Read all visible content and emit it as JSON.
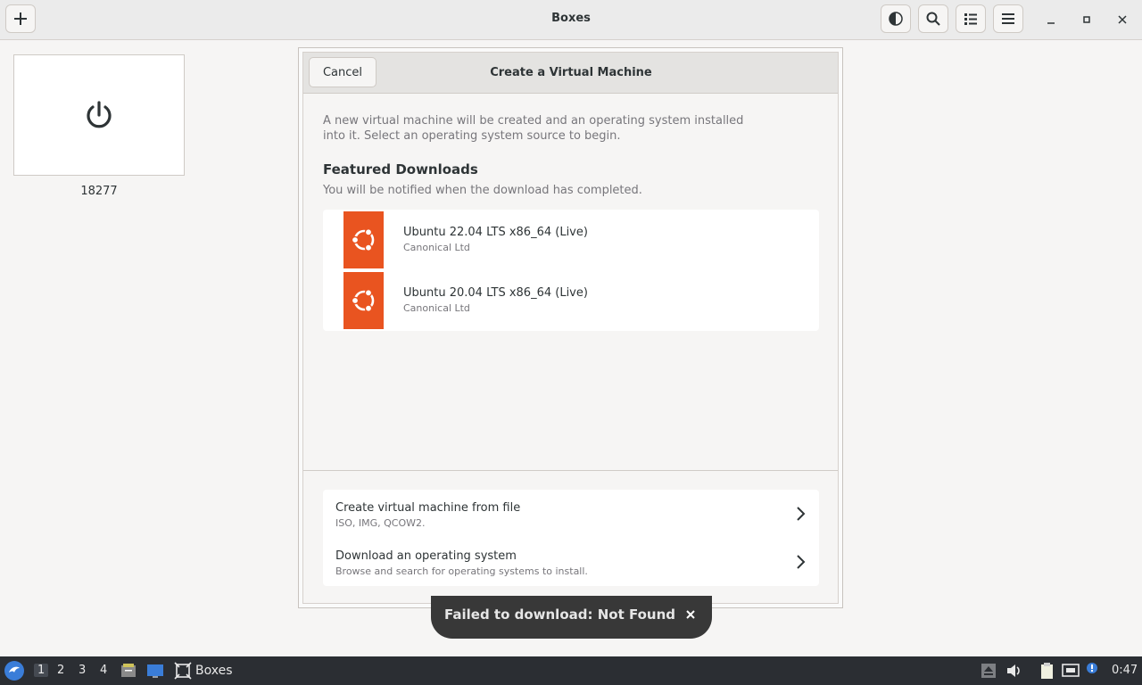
{
  "app": {
    "title": "Boxes"
  },
  "header": {
    "add_icon": "plus-icon",
    "theme_icon": "half-circle-icon",
    "search_icon": "search-icon",
    "view_icon": "list-view-icon",
    "menu_icon": "hamburger-icon"
  },
  "vm": {
    "name": "18277",
    "icon": "power-icon"
  },
  "dialog": {
    "cancel_label": "Cancel",
    "title": "Create a Virtual Machine",
    "intro_line1": "A new virtual machine will be created and an operating system installed",
    "intro_line2": "into it. Select an operating system source to begin.",
    "featured_title": "Featured Downloads",
    "featured_subtitle": "You will be notified when the download has completed.",
    "downloads": [
      {
        "name": "Ubuntu 22.04 LTS x86_64 (Live)",
        "vendor": "Canonical Ltd",
        "icon": "ubuntu-logo-icon"
      },
      {
        "name": "Ubuntu 20.04 LTS x86_64 (Live)",
        "vendor": "Canonical Ltd",
        "icon": "ubuntu-logo-icon"
      }
    ],
    "options": [
      {
        "title": "Create virtual machine from file",
        "subtitle": "ISO, IMG, QCOW2."
      },
      {
        "title": "Download an operating system",
        "subtitle": "Browse and search for operating systems to install."
      }
    ]
  },
  "toast": {
    "message": "Failed to download: Not Found"
  },
  "taskbar": {
    "workspaces": [
      "1",
      "2",
      "3",
      "4"
    ],
    "active_app": "Boxes",
    "clock": "0:47"
  },
  "colors": {
    "ubuntu_orange": "#e95420",
    "taskbar": "#2b2e33",
    "toast": "#383838"
  }
}
